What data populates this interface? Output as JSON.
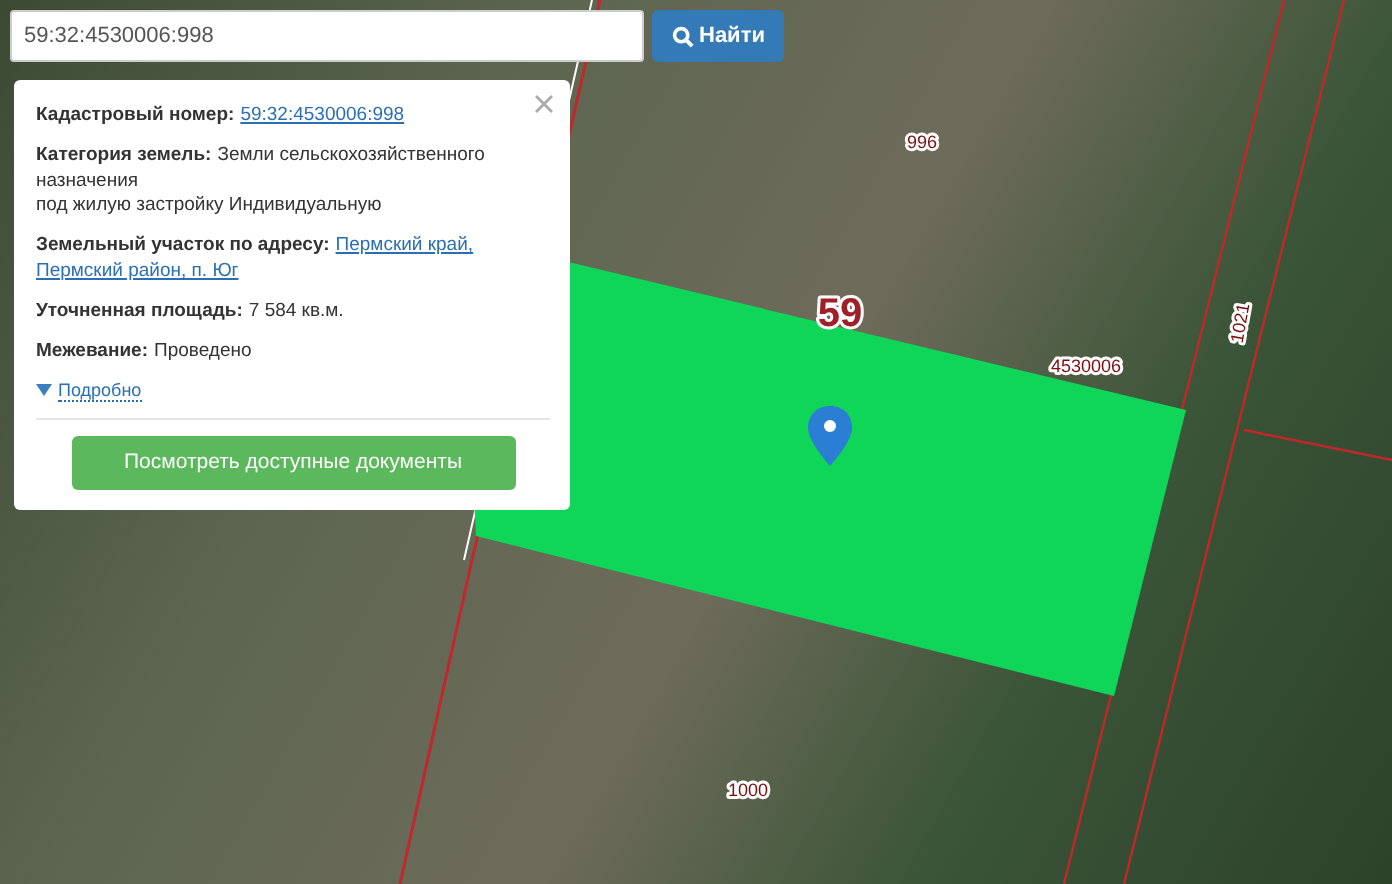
{
  "search": {
    "value": "59:32:4530006:998",
    "button": "Найти"
  },
  "map": {
    "labels": [
      {
        "text": "996",
        "kind": "small"
      },
      {
        "text": "59",
        "kind": "big"
      },
      {
        "text": "4530006",
        "kind": "small"
      },
      {
        "text": "1021",
        "kind": "vertical"
      },
      {
        "text": "1000",
        "kind": "small"
      }
    ]
  },
  "popup": {
    "fields": [
      {
        "label": "Кадастровый номер:",
        "value": "59:32:4530006:998",
        "kind": "link"
      },
      {
        "label": "Категория земель:",
        "value": "Земли сельскохозяйственного назначения\nпод жилую застройку Индивидуальную",
        "kind": "text"
      },
      {
        "label": "Земельный участок по адресу:",
        "value": "Пермский край,\nПермский район, п. Юг",
        "kind": "link"
      },
      {
        "label": "Уточненная площадь:",
        "value": "7 584 кв.м.",
        "kind": "text"
      },
      {
        "label": "Межевание:",
        "value": "Проведено",
        "kind": "text"
      }
    ],
    "details": "Подробно",
    "details_expanded": false,
    "button": "Посмотреть доступные документы"
  }
}
